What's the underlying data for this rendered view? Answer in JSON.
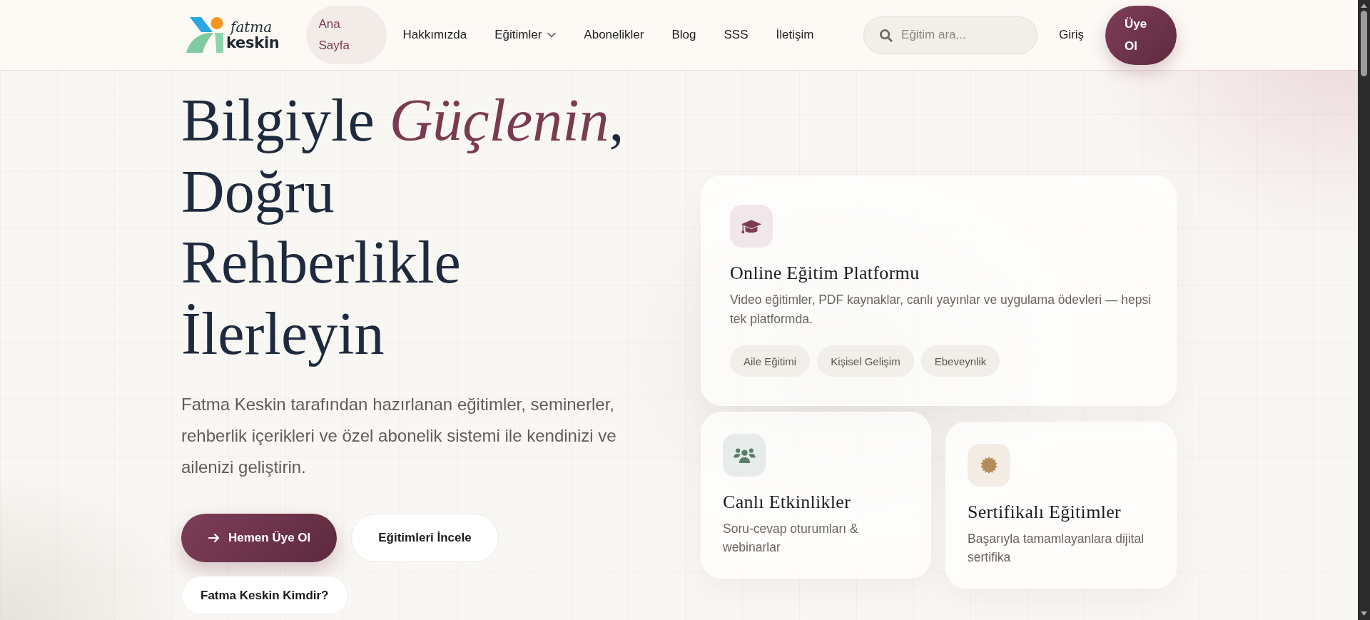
{
  "header": {
    "logo": {
      "line1": "fatma",
      "line2": "keskin"
    },
    "nav": [
      {
        "label": "Ana Sayfa",
        "selected": true,
        "dropdown": false
      },
      {
        "label": "Hakkımızda",
        "selected": false,
        "dropdown": false
      },
      {
        "label": "Eğitimler",
        "selected": false,
        "dropdown": true
      },
      {
        "label": "Abonelikler",
        "selected": false,
        "dropdown": false
      },
      {
        "label": "Blog",
        "selected": false,
        "dropdown": false
      },
      {
        "label": "SSS",
        "selected": false,
        "dropdown": false
      },
      {
        "label": "İletişim",
        "selected": false,
        "dropdown": false
      }
    ],
    "search": {
      "placeholder": "Eğitim ara..."
    },
    "login": "Giriş",
    "signup": "Üye Ol"
  },
  "hero": {
    "title_lines": [
      "Bilgiyle *Güçlenin*,",
      "Doğru",
      "Rehberlikle",
      "İlerleyin"
    ],
    "description": "Fatma Keskin tarafından hazırlanan eğitimler, seminerler, rehberlik içerikleri ve özel abonelik sistemi ile kendinizi ve ailenizi geliştirin.",
    "buttons": [
      {
        "label": "Hemen Üye Ol",
        "kind": "primary"
      },
      {
        "label": "Eğitimleri İncele",
        "kind": "secondary"
      },
      {
        "label": "Fatma Keskin Kimdir?",
        "kind": "tertiary"
      }
    ]
  },
  "features": [
    {
      "kind": "large",
      "title": "Online Eğitim Platformu",
      "description": "Video eğitimler, PDF kaynaklar, canlı yayınlar ve uygulama ödevleri — hepsi tek platformda.",
      "tags": [
        "Aile Eğitimi",
        "Kişisel Gelişim",
        "Ebeveynlik"
      ]
    },
    {
      "kind": "small",
      "title": "Canlı Etkinlikler",
      "description": "Soru-cevap oturumları & webinarlar"
    },
    {
      "kind": "small",
      "title": "Sertifikalı Eğitimler",
      "description": "Başarıyla tamamlayanlara dijital sertifika"
    }
  ]
}
